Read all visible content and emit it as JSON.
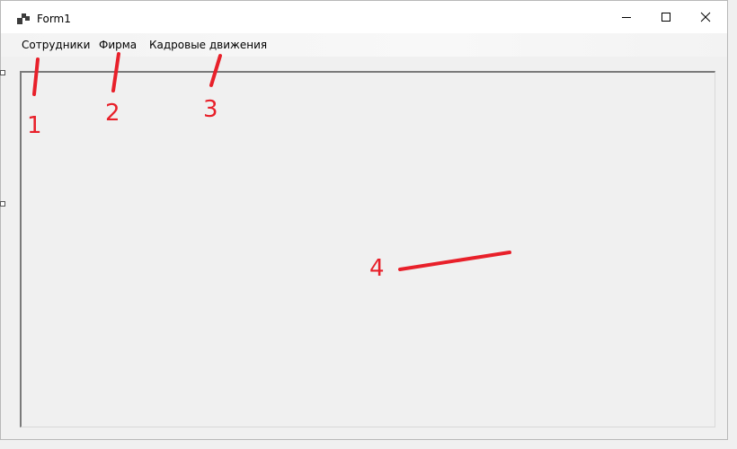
{
  "window": {
    "title": "Form1",
    "icon": "form-app-icon",
    "controls": [
      "minimize-icon",
      "maximize-icon",
      "close-icon"
    ]
  },
  "menubar": {
    "items": [
      {
        "label": "Сотрудники"
      },
      {
        "label": "Фирма"
      },
      {
        "label": "Кадровые движения"
      }
    ]
  },
  "annotations": {
    "labels": [
      "1",
      "2",
      "3",
      "4"
    ],
    "color": "#e8202a"
  },
  "colors": {
    "window_bg": "#f0f0f0",
    "titlebar_bg": "#ffffff"
  }
}
